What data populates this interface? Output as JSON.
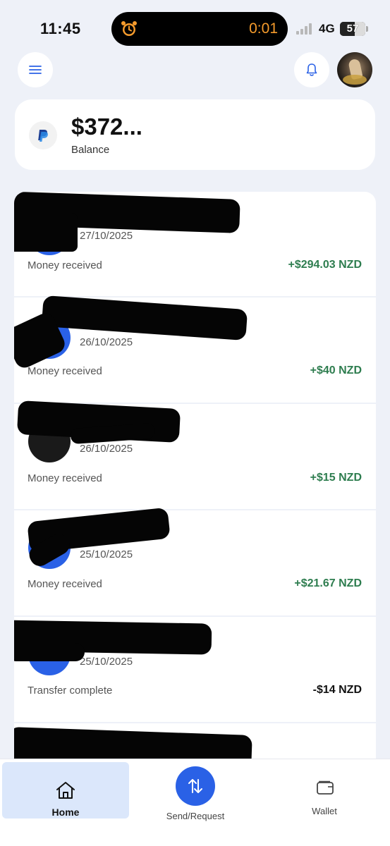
{
  "status_bar": {
    "time": "11:45",
    "timer": "0:01",
    "network": "4G",
    "battery": "57"
  },
  "balance": {
    "amount": "$372...",
    "label": "Balance"
  },
  "transactions": [
    {
      "date": "27/10/2025",
      "status": "Money received",
      "amount": "+$294.03 NZD",
      "direction": "in"
    },
    {
      "date": "26/10/2025",
      "status": "Money received",
      "amount": "+$40 NZD",
      "direction": "in"
    },
    {
      "date": "26/10/2025",
      "status": "Money received",
      "amount": "+$15 NZD",
      "direction": "in"
    },
    {
      "date": "25/10/2025",
      "status": "Money received",
      "amount": "+$21.67 NZD",
      "direction": "in"
    },
    {
      "date": "25/10/2025",
      "status": "Transfer complete",
      "amount": "-$14 NZD",
      "direction": "out"
    }
  ],
  "nav": {
    "home": "Home",
    "send": "Send/Request",
    "wallet": "Wallet"
  },
  "colors": {
    "accent": "#2a61e6",
    "positive": "#2e7d4f",
    "background": "#eef1f8"
  }
}
